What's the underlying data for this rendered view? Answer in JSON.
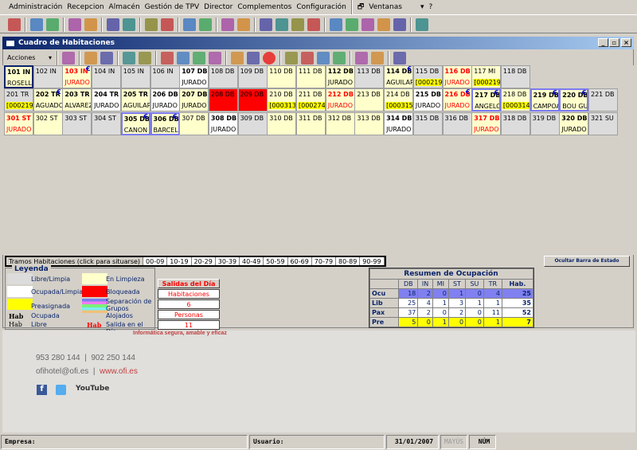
{
  "menu": [
    "Administración",
    "Recepcion",
    "Almacén",
    "Gestión de TPV",
    "Director",
    "Complementos",
    "Configuración",
    "Ventanas",
    "?"
  ],
  "main_toolbar_icons": [
    "exit-icon",
    "phone-icon",
    "handshake-icon",
    "cash-register-icon",
    "book-icon",
    "puzzle-icon",
    "line-chart-icon",
    "pie-chart-icon",
    "rooms-icon",
    "rooms-edit-icon",
    "reservations-icon",
    "invoice-i-icon",
    "invoice-g-icon",
    "form-icon",
    "edit-icon",
    "cart-green-icon",
    "cart-purple-icon",
    "grid-icon",
    "grid-eh-icon",
    "hab-icon",
    "search-icon",
    "report-icon",
    "tools-icon"
  ],
  "window": {
    "title": "Cuadro de Habitaciones",
    "acciones": "Acciones"
  },
  "window_toolbar_icons": [
    "exit-icon",
    "checkin-icon",
    "checkin-disabled-icon",
    "move-icon",
    "move2-icon",
    "euro-icon",
    "list-icon",
    "out-icon",
    "cart-icon",
    "cleaning-icon",
    "split-icon",
    "block-icon",
    "key-icon",
    "print-icon",
    "print-preview-icon",
    "reprint-icon",
    "grid-icon",
    "layout-icon",
    "forward-icon"
  ],
  "colors": {
    "libre": "#dcdcdc",
    "ocupada": "#ffffff",
    "limpieza": "#ffffcc",
    "bloqueada": "#ff0000",
    "preasignada": "#ffff00",
    "ocu_row": "#8080f0"
  },
  "rooms": [
    [
      {
        "n": "101 IN",
        "t": "ROSELL",
        "s": "limpieza",
        "b": 1,
        "sel": 1
      },
      {
        "n": "102 IN",
        "s": "libre"
      },
      {
        "n": "103 IN",
        "t": "JURADO",
        "s": "limpieza",
        "b": 1,
        "r": 1,
        "e": 1
      },
      {
        "n": "104 IN",
        "s": "libre"
      },
      {
        "n": "105 IN",
        "s": "libre"
      },
      {
        "n": "106 IN",
        "s": "libre"
      },
      {
        "n": "107 DB",
        "t": "JURADO",
        "s": "ocupada",
        "b": 1
      },
      {
        "n": "108 DB",
        "s": "libre"
      },
      {
        "n": "109 DB",
        "s": "libre"
      },
      {
        "n": "110 DB",
        "s": "limpieza"
      },
      {
        "n": "111 DB",
        "s": "limpieza"
      },
      {
        "n": "112 DB",
        "t": "JURADO",
        "s": "limpieza",
        "b": 1
      },
      {
        "n": "113 DB",
        "s": "libre"
      },
      {
        "n": "114 DB",
        "t": "AGUILAR",
        "s": "limpieza",
        "b": 1,
        "e": 1
      },
      {
        "n": "115 DB",
        "t": "[000219-",
        "s": "libre",
        "p": 1
      },
      {
        "n": "116 DB",
        "t": "JURADO",
        "s": "limpieza",
        "b": 1,
        "r": 1
      },
      {
        "n": "117 MI",
        "t": "[000219-",
        "s": "limpieza",
        "p": 1
      },
      {
        "n": "118 DB",
        "s": "libre"
      }
    ],
    [
      {
        "n": "201 TR",
        "t": "[000219-",
        "s": "libre",
        "p": 1
      },
      {
        "n": "202 TR",
        "t": "AGUADO",
        "s": "limpieza",
        "b": 1,
        "e": 1
      },
      {
        "n": "203 TR",
        "t": "ALVAREZ",
        "s": "limpieza",
        "b": 1
      },
      {
        "n": "204 TR",
        "t": "JURADO",
        "s": "ocupada",
        "b": 1
      },
      {
        "n": "205 TR",
        "t": "AGUILAR",
        "s": "limpieza",
        "b": 1
      },
      {
        "n": "206 DB",
        "t": "JURADO",
        "s": "ocupada",
        "b": 1
      },
      {
        "n": "207 DB",
        "t": "JURADO",
        "s": "limpieza",
        "b": 1
      },
      {
        "n": "208 DB",
        "s": "bloqueada"
      },
      {
        "n": "209 DB",
        "s": "bloqueada"
      },
      {
        "n": "210 DB",
        "t": "[000313]",
        "s": "limpieza",
        "p": 1
      },
      {
        "n": "211 DB",
        "t": "[000274]",
        "s": "limpieza",
        "p": 1
      },
      {
        "n": "212 DB",
        "t": "JURADO",
        "s": "limpieza",
        "b": 1,
        "r": 1
      },
      {
        "n": "213 DB",
        "s": "limpieza"
      },
      {
        "n": "214 DB",
        "t": "[000315]",
        "s": "limpieza",
        "p": 1
      },
      {
        "n": "215 DB",
        "t": "JURADO",
        "s": "ocupada",
        "b": 1
      },
      {
        "n": "216 DB",
        "t": "JURADO",
        "s": "limpieza",
        "b": 1,
        "r": 1,
        "e": 1
      },
      {
        "n": "217 DB",
        "t": "ANGELO",
        "s": "limpieza",
        "b": 1,
        "e": 1,
        "g": 1
      },
      {
        "n": "218 DB",
        "t": "[000314]",
        "s": "limpieza",
        "p": 1
      },
      {
        "n": "219 DB",
        "t": "CAMPOA",
        "s": "limpieza",
        "b": 1,
        "e": 1,
        "g": 1
      },
      {
        "n": "220 DB",
        "t": "BOU GUI",
        "s": "limpieza",
        "b": 1,
        "e": 1,
        "g": 1
      },
      {
        "n": "221 DB",
        "s": "libre"
      }
    ],
    [
      {
        "n": "301 ST",
        "t": "JURADO",
        "s": "limpieza",
        "b": 1,
        "r": 1
      },
      {
        "n": "302 ST",
        "s": "limpieza"
      },
      {
        "n": "303 ST",
        "s": "libre"
      },
      {
        "n": "304 ST",
        "s": "libre"
      },
      {
        "n": "305 DB",
        "t": "CANON S",
        "s": "limpieza",
        "b": 1,
        "e": 1,
        "g": 1
      },
      {
        "n": "306 DB",
        "t": "BARCEL",
        "s": "limpieza",
        "b": 1,
        "e": 1,
        "g": 1
      },
      {
        "n": "307 DB",
        "s": "limpieza"
      },
      {
        "n": "308 DB",
        "t": "JURADO",
        "s": "ocupada",
        "b": 1
      },
      {
        "n": "309 DB",
        "s": "libre"
      },
      {
        "n": "310 DB",
        "s": "limpieza"
      },
      {
        "n": "311 DB",
        "s": "limpieza"
      },
      {
        "n": "312 DB",
        "s": "limpieza"
      },
      {
        "n": "313 DB",
        "s": "limpieza"
      },
      {
        "n": "314 DB",
        "t": "JURADO",
        "s": "ocupada",
        "b": 1
      },
      {
        "n": "315 DB",
        "s": "libre"
      },
      {
        "n": "316 DB",
        "s": "libre"
      },
      {
        "n": "317 DB",
        "t": "JURADO",
        "s": "limpieza",
        "b": 1,
        "r": 1
      },
      {
        "n": "318 DB",
        "s": "libre"
      },
      {
        "n": "319 DB",
        "s": "libre"
      },
      {
        "n": "320 DB",
        "t": "JURADO",
        "s": "limpieza",
        "b": 1
      },
      {
        "n": "321 SU",
        "s": "libre"
      }
    ]
  ],
  "euro_symbol": "€",
  "tramos": [
    "Tramos Habitaciones (click para situarse)",
    "00-09",
    "10-19",
    "20-29",
    "30-39",
    "40-49",
    "50-59",
    "60-69",
    "70-79",
    "80-89",
    "90-99"
  ],
  "ocultar_button": "Ocultar Barra de Estado",
  "leyenda": {
    "title": "Leyenda",
    "libre": "Libre/Limpia",
    "ocupada": "Ocupada/Limpia",
    "preasignada": "Preasignada",
    "hab": "Hab",
    "ocupada_bold": "Ocupada",
    "libre_normal": "Libre",
    "limpieza": "En Limpieza",
    "bloqueada": "Bloqueada",
    "grupos": "Separación de Grupos Alojados",
    "salida": "Salida en el Día"
  },
  "salidas": {
    "title": "Salidas del Día",
    "habitaciones_label": "Habitaciones",
    "habitaciones": "6",
    "personas_label": "Personas",
    "personas": "11"
  },
  "resumen": {
    "title": "Resumen de Ocupación",
    "cols": [
      "DB",
      "IN",
      "MI",
      "ST",
      "SU",
      "TR",
      "Hab."
    ],
    "rows": [
      {
        "label": "Ocu",
        "values": [
          "18",
          "2",
          "0",
          "1",
          "0",
          "4",
          "25"
        ]
      },
      {
        "label": "Lib",
        "values": [
          "25",
          "4",
          "1",
          "3",
          "1",
          "1",
          "35"
        ]
      },
      {
        "label": "Pax",
        "values": [
          "37",
          "2",
          "0",
          "2",
          "0",
          "11",
          "52"
        ]
      },
      {
        "label": "Pre",
        "values": [
          "5",
          "0",
          "1",
          "0",
          "0",
          "1",
          "7"
        ]
      }
    ]
  },
  "background": {
    "tagline": "Informática segura, amable y eficaz",
    "phone1": "953 280 144",
    "phone2": "902 250 144",
    "email": "ofihotel@ofi.es",
    "web": "www.ofi.es",
    "youtube": "YouTube"
  },
  "status": {
    "empresa": "Empresa:",
    "usuario": "Usuario:",
    "date": "31/01/2007",
    "mayus": "MAYÚS",
    "num": "NÚM"
  }
}
